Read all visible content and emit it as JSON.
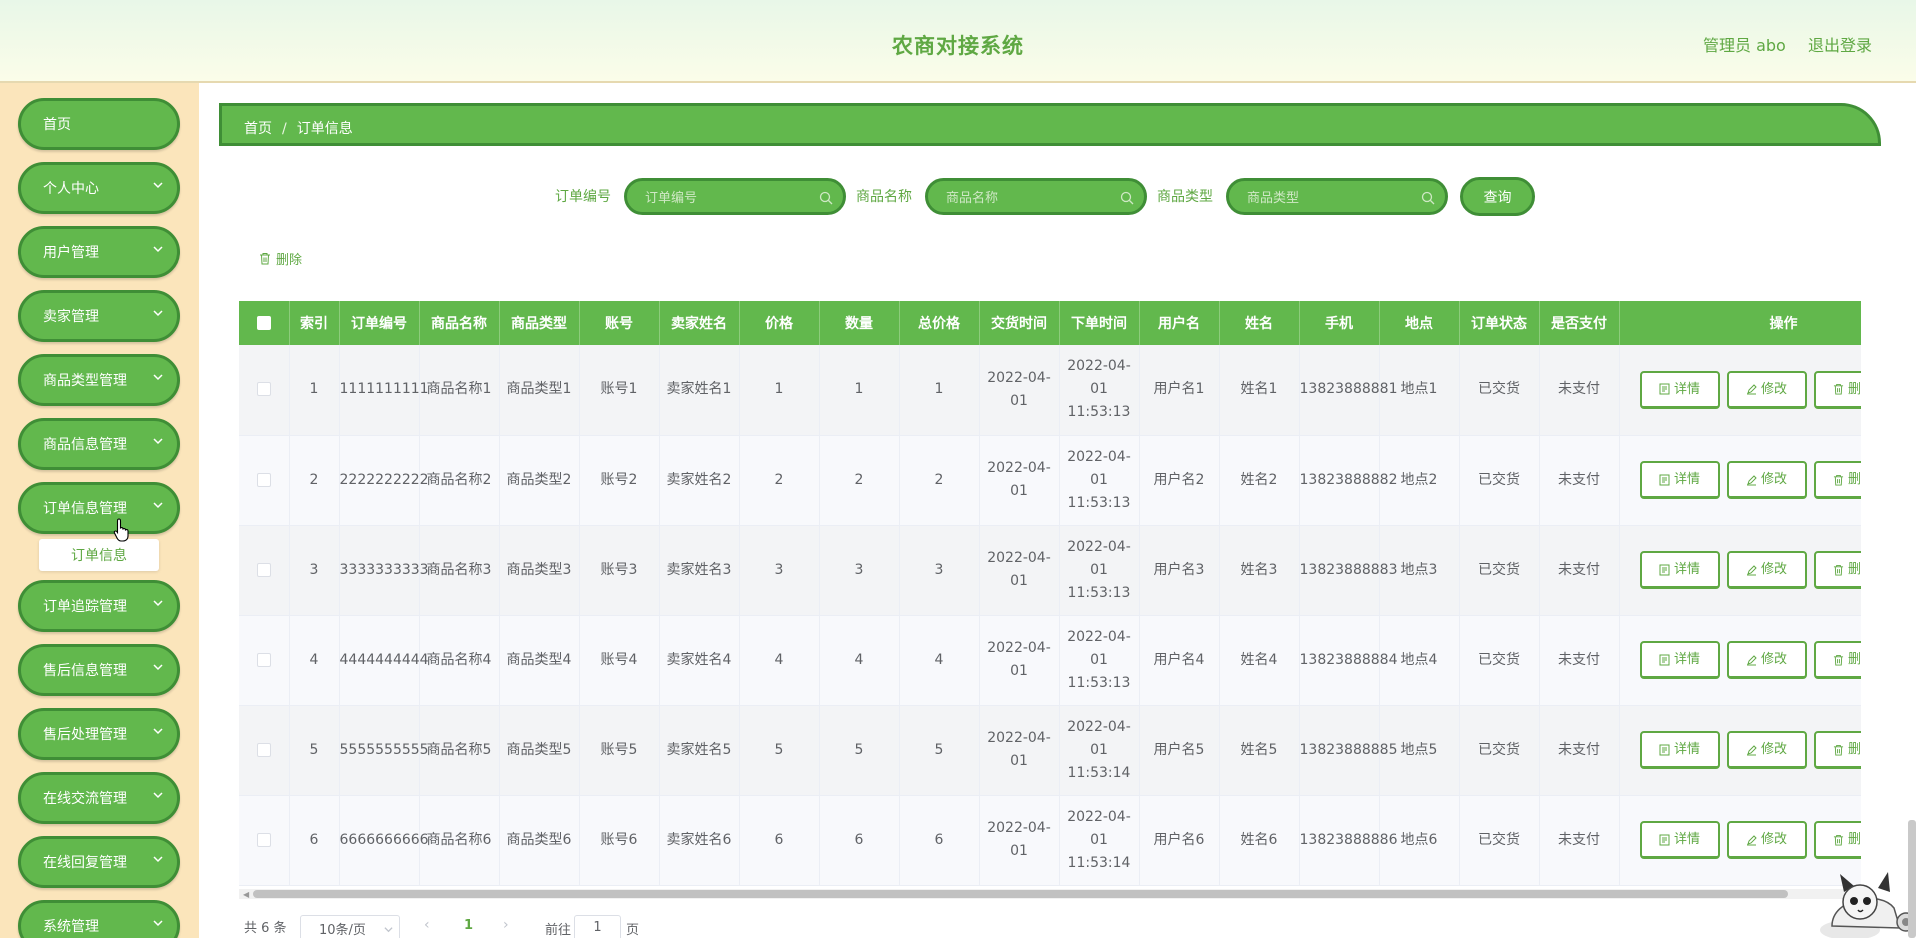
{
  "header": {
    "title": "农商对接系统",
    "user": "管理员 abo",
    "logout": "退出登录"
  },
  "sidebar": {
    "items": [
      {
        "label": "首页",
        "has_arrow": false
      },
      {
        "label": "个人中心",
        "has_arrow": true
      },
      {
        "label": "用户管理",
        "has_arrow": true
      },
      {
        "label": "卖家管理",
        "has_arrow": true
      },
      {
        "label": "商品类型管理",
        "has_arrow": true
      },
      {
        "label": "商品信息管理",
        "has_arrow": true
      },
      {
        "label": "订单信息管理",
        "has_arrow": true
      },
      {
        "label": "订单追踪管理",
        "has_arrow": true
      },
      {
        "label": "售后信息管理",
        "has_arrow": true
      },
      {
        "label": "售后处理管理",
        "has_arrow": true
      },
      {
        "label": "在线交流管理",
        "has_arrow": true
      },
      {
        "label": "在线回复管理",
        "has_arrow": true
      },
      {
        "label": "系统管理",
        "has_arrow": true
      }
    ],
    "submenu_label": "订单信息"
  },
  "breadcrumb": {
    "home": "首页",
    "separator": "/",
    "current": "订单信息"
  },
  "search": {
    "fields": [
      {
        "label": "订单编号",
        "placeholder": "订单编号"
      },
      {
        "label": "商品名称",
        "placeholder": "商品名称"
      },
      {
        "label": "商品类型",
        "placeholder": "商品类型"
      }
    ],
    "query_label": "查询"
  },
  "toolbar": {
    "delete_label": "删除"
  },
  "table": {
    "headers": [
      "索引",
      "订单编号",
      "商品名称",
      "商品类型",
      "账号",
      "卖家姓名",
      "价格",
      "数量",
      "总价格",
      "交货时间",
      "下单时间",
      "用户名",
      "姓名",
      "手机",
      "地点",
      "订单状态",
      "是否支付",
      "操作"
    ],
    "rows": [
      [
        "1",
        "1111111111",
        "商品名称1",
        "商品类型1",
        "账号1",
        "卖家姓名1",
        "1",
        "1",
        "1",
        "2022-04-01",
        "2022-04-01 11:53:13",
        "用户名1",
        "姓名1",
        "13823888881",
        "地点1",
        "已交货",
        "未支付"
      ],
      [
        "2",
        "2222222222",
        "商品名称2",
        "商品类型2",
        "账号2",
        "卖家姓名2",
        "2",
        "2",
        "2",
        "2022-04-01",
        "2022-04-01 11:53:13",
        "用户名2",
        "姓名2",
        "13823888882",
        "地点2",
        "已交货",
        "未支付"
      ],
      [
        "3",
        "3333333333",
        "商品名称3",
        "商品类型3",
        "账号3",
        "卖家姓名3",
        "3",
        "3",
        "3",
        "2022-04-01",
        "2022-04-01 11:53:13",
        "用户名3",
        "姓名3",
        "13823888883",
        "地点3",
        "已交货",
        "未支付"
      ],
      [
        "4",
        "4444444444",
        "商品名称4",
        "商品类型4",
        "账号4",
        "卖家姓名4",
        "4",
        "4",
        "4",
        "2022-04-01",
        "2022-04-01 11:53:13",
        "用户名4",
        "姓名4",
        "13823888884",
        "地点4",
        "已交货",
        "未支付"
      ],
      [
        "5",
        "5555555555",
        "商品名称5",
        "商品类型5",
        "账号5",
        "卖家姓名5",
        "5",
        "5",
        "5",
        "2022-04-01",
        "2022-04-01 11:53:14",
        "用户名5",
        "姓名5",
        "13823888885",
        "地点5",
        "已交货",
        "未支付"
      ],
      [
        "6",
        "6666666666",
        "商品名称6",
        "商品类型6",
        "账号6",
        "卖家姓名6",
        "6",
        "6",
        "6",
        "2022-04-01",
        "2022-04-01 11:53:14",
        "用户名6",
        "姓名6",
        "13823888886",
        "地点6",
        "已交货",
        "未支付"
      ]
    ],
    "actions": {
      "detail": "详情",
      "edit": "修改",
      "delete": "删除"
    }
  },
  "pagination": {
    "total": "共 6 条",
    "page_size": "10条/页",
    "prev": "‹",
    "current": "1",
    "next": "›",
    "goto": "前往",
    "goto_value": "1",
    "page_suffix": "页"
  },
  "colors": {
    "brand_green": "#62b84d",
    "dark_green": "#3f8e36",
    "text_green": "#5fa843",
    "sidebar_bg": "#fbe5bb"
  }
}
